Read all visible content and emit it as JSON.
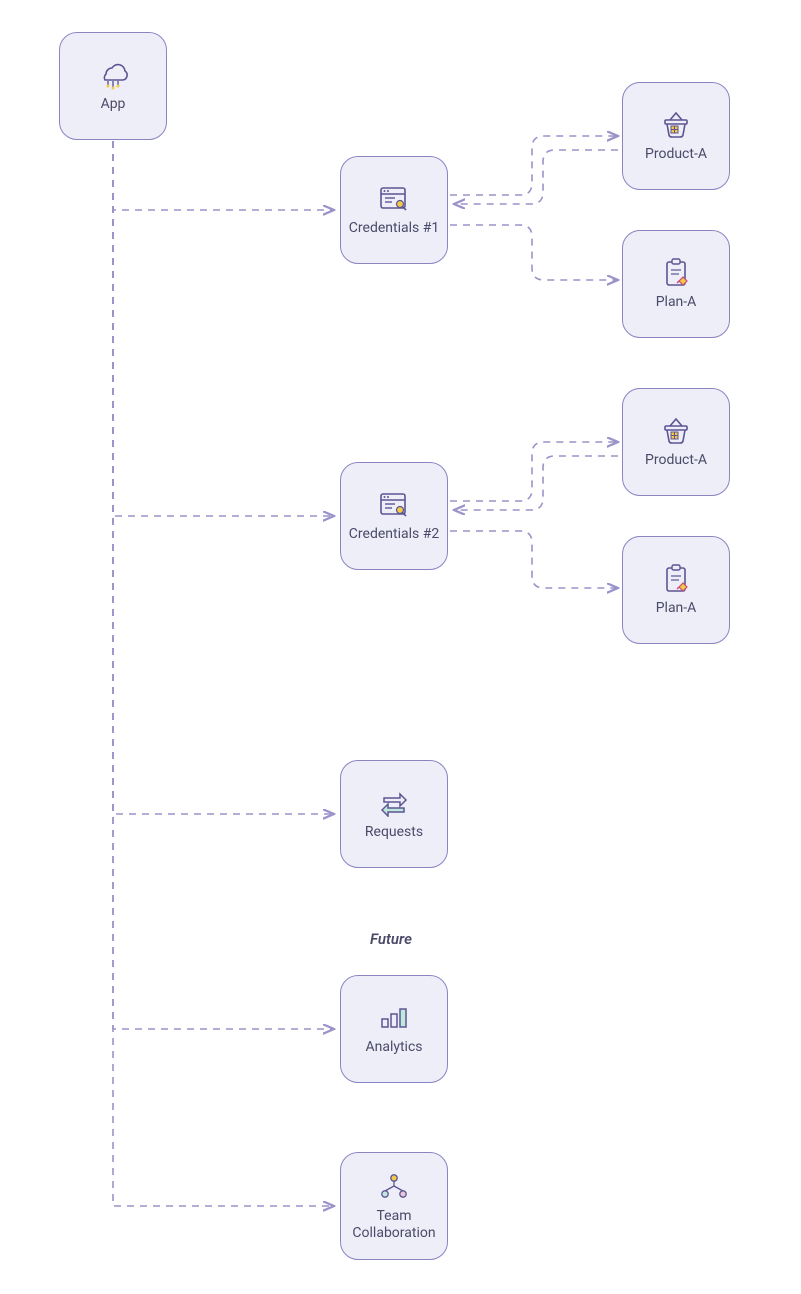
{
  "nodes": {
    "app": {
      "label": "App"
    },
    "cred1": {
      "label": "Credentials #1"
    },
    "cred2": {
      "label": "Credentials #2"
    },
    "productA1": {
      "label": "Product-A"
    },
    "planA1": {
      "label": "Plan-A"
    },
    "productA2": {
      "label": "Product-A"
    },
    "planA2": {
      "label": "Plan-A"
    },
    "requests": {
      "label": "Requests"
    },
    "analytics": {
      "label": "Analytics"
    },
    "team": {
      "label": "Team Collaboration"
    }
  },
  "sectionLabel": "Future",
  "colors": {
    "nodeFill": "#eeeef9",
    "nodeBorder": "#8a84c2",
    "edge": "#9a93c9",
    "text": "#4a4a68"
  }
}
